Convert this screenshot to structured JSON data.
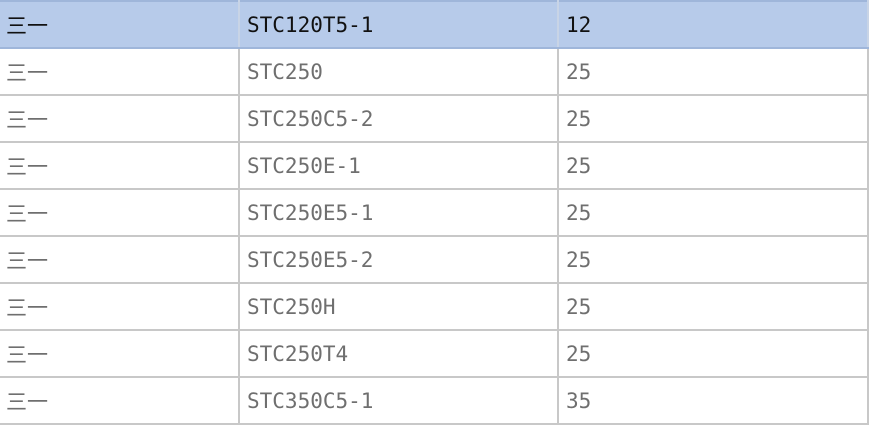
{
  "table": {
    "rows": [
      {
        "name": "三一",
        "model": "STC120T5-1",
        "value": "12",
        "selected": true
      },
      {
        "name": "三一",
        "model": "STC250",
        "value": "25",
        "selected": false
      },
      {
        "name": "三一",
        "model": "STC250C5-2",
        "value": "25",
        "selected": false
      },
      {
        "name": "三一",
        "model": "STC250E-1",
        "value": "25",
        "selected": false
      },
      {
        "name": "三一",
        "model": "STC250E5-1",
        "value": "25",
        "selected": false
      },
      {
        "name": "三一",
        "model": "STC250E5-2",
        "value": "25",
        "selected": false
      },
      {
        "name": "三一",
        "model": "STC250H",
        "value": "25",
        "selected": false
      },
      {
        "name": "三一",
        "model": "STC250T4",
        "value": "25",
        "selected": false
      },
      {
        "name": "三一",
        "model": "STC350C5-1",
        "value": "35",
        "selected": false
      }
    ]
  },
  "colors": {
    "selected_row_bg": "#b7cbea",
    "grid_line": "#c8c8c8",
    "text": "#6f6f6f",
    "selected_text": "#111111"
  }
}
